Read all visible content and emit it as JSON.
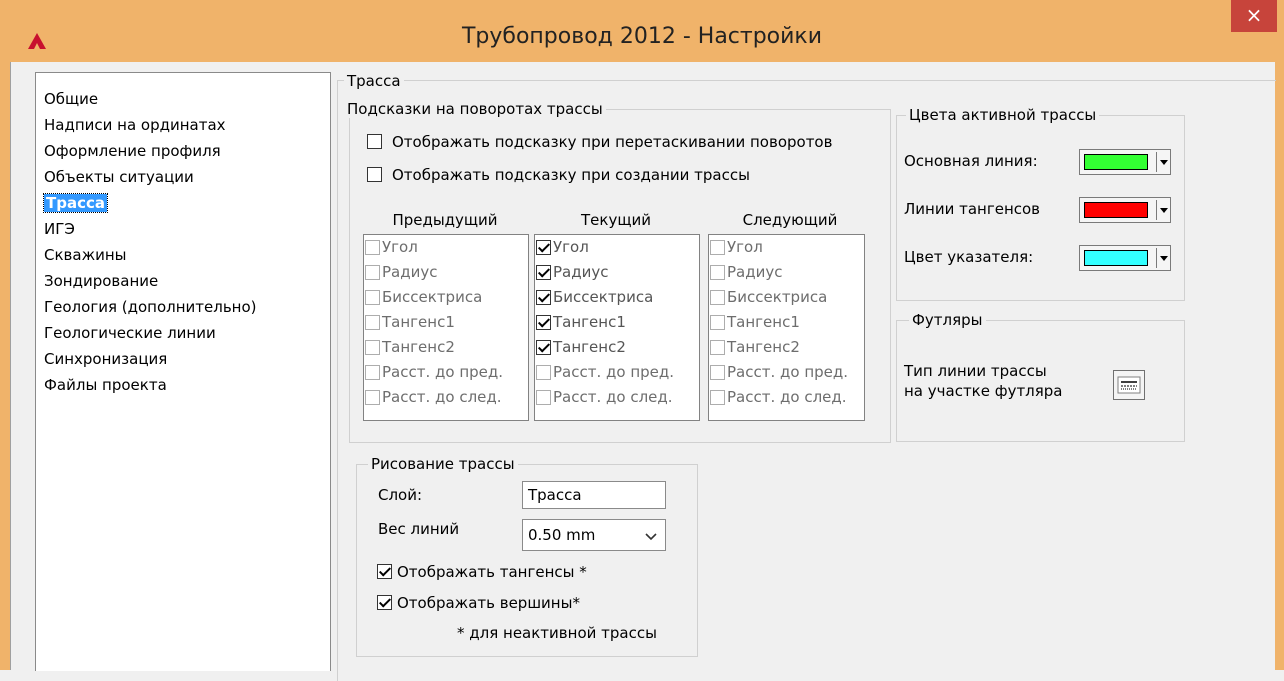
{
  "window": {
    "title": "Трубопровод 2012 - Настройки",
    "close_glyph": "×"
  },
  "sidebar": {
    "items": [
      {
        "label": "Общие"
      },
      {
        "label": "Надписи на ординатах"
      },
      {
        "label": "Оформление профиля"
      },
      {
        "label": "Объекты ситуации"
      },
      {
        "label": "Трасса",
        "selected": true
      },
      {
        "label": "ИГЭ"
      },
      {
        "label": "Скважины"
      },
      {
        "label": "Зондирование"
      },
      {
        "label": "Геология (дополнительно)"
      },
      {
        "label": "Геологические линии"
      },
      {
        "label": "Синхронизация"
      },
      {
        "label": "Файлы проекта"
      }
    ]
  },
  "route": {
    "group_title": "Трасса",
    "hints": {
      "title": "Подсказки на поворотах трассы",
      "show_on_drag": {
        "label": "Отображать подсказку при перетаскивании поворотов",
        "checked": false
      },
      "show_on_create": {
        "label": "Отображать подсказку при создании трассы",
        "checked": false
      },
      "columns": [
        {
          "header": "Предыдущий",
          "items": [
            {
              "label": "Угол",
              "checked": false
            },
            {
              "label": "Радиус",
              "checked": false
            },
            {
              "label": "Биссектриса",
              "checked": false
            },
            {
              "label": "Тангенс1",
              "checked": false
            },
            {
              "label": "Тангенс2",
              "checked": false
            },
            {
              "label": "Расст. до пред.",
              "checked": false
            },
            {
              "label": "Расст. до след.",
              "checked": false
            }
          ]
        },
        {
          "header": "Текущий",
          "items": [
            {
              "label": "Угол",
              "checked": true
            },
            {
              "label": "Радиус",
              "checked": true
            },
            {
              "label": "Биссектриса",
              "checked": true
            },
            {
              "label": "Тангенс1",
              "checked": true
            },
            {
              "label": "Тангенс2",
              "checked": true
            },
            {
              "label": "Расст. до пред.",
              "checked": false
            },
            {
              "label": "Расст. до след.",
              "checked": false
            }
          ]
        },
        {
          "header": "Следующий",
          "items": [
            {
              "label": "Угол",
              "checked": false
            },
            {
              "label": "Радиус",
              "checked": false
            },
            {
              "label": "Биссектриса",
              "checked": false
            },
            {
              "label": "Тангенс1",
              "checked": false
            },
            {
              "label": "Тангенс2",
              "checked": false
            },
            {
              "label": "Расст. до пред.",
              "checked": false
            },
            {
              "label": "Расст. до след.",
              "checked": false
            }
          ]
        }
      ]
    },
    "drawing": {
      "title": "Рисование трассы",
      "layer_label": "Слой:",
      "layer_value": "Трасса",
      "lineweight_label": "Вес линий",
      "lineweight_value": "0.50 mm",
      "show_tangents": {
        "label": "Отображать тангенсы *",
        "checked": true
      },
      "show_vertices": {
        "label": "Отображать вершины*",
        "checked": true
      },
      "note": "* для неактивной трассы"
    },
    "colors": {
      "title": "Цвета активной трассы",
      "items": [
        {
          "label": "Основная линия:",
          "color": "#33ff33"
        },
        {
          "label": "Линии  тангенсов",
          "color": "#ff0000"
        },
        {
          "label": "Цвет указателя:",
          "color": "#33ffff"
        }
      ]
    },
    "cases": {
      "title": "Футляры",
      "linetype_label_1": "Тип линии трассы",
      "linetype_label_2": "на участке футляра"
    }
  }
}
